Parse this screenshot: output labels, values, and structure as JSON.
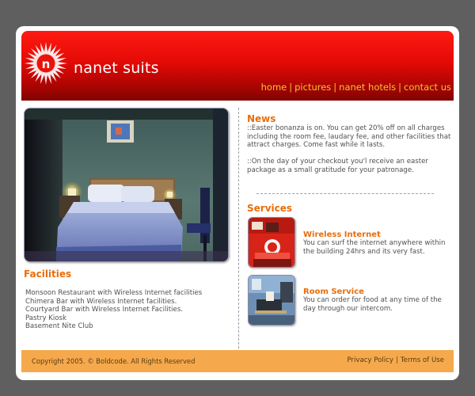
{
  "brand": {
    "name": "nanet suits",
    "logo_letter": "n"
  },
  "nav": {
    "items": [
      "home",
      "pictures",
      "nanet hotels",
      "contact us"
    ],
    "separator": "|"
  },
  "facilities": {
    "title": "Facilities",
    "items": [
      "Monsoon Restaurant with Wireless Internet facilities",
      "Chimera Bar with Wireless Internet facilities.",
      "Courtyard Bar with Wireless Internet Facilities.",
      "Pastry Kiosk",
      "Basement Nite Club"
    ]
  },
  "news": {
    "title": "News",
    "paragraphs": [
      "::Easter bonanza is on. You can get 20% off on all charges including the room fee, laudary fee, and other facilities that attract charges. Come fast while it lasts.",
      "::On the day of your checkout you'l receive an easter package as a small gratitude for your patronage."
    ]
  },
  "services": {
    "title": "Services",
    "items": [
      {
        "title": "Wireless Internet",
        "description": "You can surf the internet anywhere within the building 24hrs and its very fast."
      },
      {
        "title": "Room Service",
        "description": "You can order for food at any time of the day through our intercom."
      }
    ]
  },
  "footer": {
    "copyright": "Copyright 2005. © Boldcode. All Rights Reserved",
    "links": [
      "Privacy Policy",
      "Terms of Use"
    ],
    "separator": "|"
  },
  "colors": {
    "background": "#5f5f5f",
    "header_red": "#e40a06",
    "nav_gold": "#f6c233",
    "section_orange": "#e96d0a",
    "footer_orange": "#f5a94c"
  },
  "icons": [
    "sunburst-logo-icon"
  ]
}
